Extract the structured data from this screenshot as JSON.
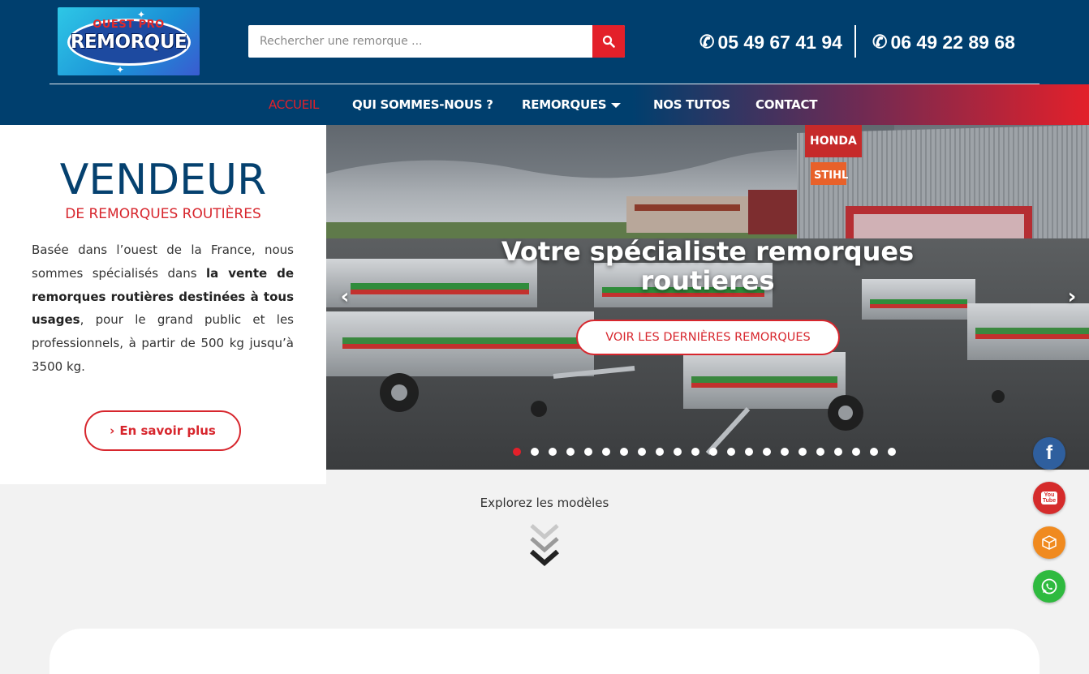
{
  "header": {
    "logo": {
      "top_word": "OUEST PRO",
      "main_word": "REMORQUE"
    },
    "search": {
      "placeholder": "Rechercher une remorque ..."
    },
    "phones": [
      "05 49 67 41 94",
      "06 49 22 89 68"
    ]
  },
  "nav": {
    "items": [
      {
        "label": "ACCUEIL",
        "active": true
      },
      {
        "label": "QUI SOMMES-NOUS ?",
        "active": false
      },
      {
        "label": "REMORQUES",
        "active": false,
        "dropdown": true
      },
      {
        "label": "NOS TUTOS",
        "active": false
      },
      {
        "label": "CONTACT",
        "active": false
      }
    ]
  },
  "intro": {
    "title": "VENDEUR",
    "subtitle": "DE REMORQUES ROUTIÈRES",
    "text_1": "Basée dans l’ouest de la France, nous sommes spécialisés dans ",
    "text_bold": "la vente de remorques routières destinées à tous usages",
    "text_2": ", pour le grand public et les professionnels, à partir de 500 kg jusqu’à 3500 kg.",
    "button": "En savoir plus"
  },
  "slider": {
    "title": "Votre spécialiste remorques routieres",
    "button": "VOIR LES DERNIÈRES REMORQUES",
    "dot_count": 22,
    "active_dot": 0,
    "store_signs": [
      "HONDA",
      "STIHL"
    ]
  },
  "explore": {
    "label": "Explorez les modèles"
  },
  "social": [
    "facebook-icon",
    "youtube-icon",
    "cube-icon",
    "whatsapp-icon"
  ],
  "social_labels": {
    "facebook": "f",
    "youtube_top": "You",
    "youtube_bottom": "Tube"
  },
  "colors": {
    "primary": "#003f6e",
    "accent": "#e3202a",
    "title_blue": "#05416f"
  }
}
